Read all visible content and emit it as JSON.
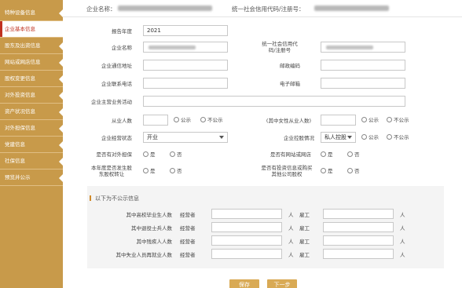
{
  "sidebar": {
    "items": [
      {
        "label": "特种设备信息"
      },
      {
        "label": "企业基本信息"
      },
      {
        "label": "股东及出资信息"
      },
      {
        "label": "网站或网店信息"
      },
      {
        "label": "股权变更信息"
      },
      {
        "label": "对外投资信息"
      },
      {
        "label": "资产状况信息"
      },
      {
        "label": "对外担保信息"
      },
      {
        "label": "党建信息"
      },
      {
        "label": "社保信息"
      },
      {
        "label": "预览并公示"
      }
    ]
  },
  "header": {
    "company_name_label": "企业名称：",
    "credit_code_label": "统一社会信用代码/注册号："
  },
  "form": {
    "report_year_label": "报告年度",
    "report_year_value": "2021",
    "company_name_label": "企业名称",
    "credit_code_label": "统一社会信用代码/注册号",
    "mailing_address_label": "企业通信地址",
    "postal_code_label": "邮政编码",
    "contact_phone_label": "企业联系电话",
    "email_label": "电子邮箱",
    "main_business_label": "企业主营业务活动",
    "employees_label": "从业人数",
    "female_employees_label": "(其中女性从业人数)",
    "public_label": "公示",
    "not_public_label": "不公示",
    "operating_status_label": "企业经营状态",
    "operating_status_value": "开业",
    "holding_label": "企业控股情况",
    "holding_value": "私人控股",
    "external_guarantee_label": "是否有对外担保",
    "website_label": "是否有网站或网店",
    "yes_label": "是",
    "no_label": "否",
    "equity_transfer_label": "本年度是否发生股东股权转让",
    "invest_label": "是否有投资信息或购买其他公司股权"
  },
  "non_public": {
    "title": "以下为不公示信息",
    "rows": [
      {
        "label": "其中高校毕业生人数",
        "operator": "经营者",
        "employee": "雇工",
        "unit": "人"
      },
      {
        "label": "其中退役士兵人数",
        "operator": "经营者",
        "employee": "雇工",
        "unit": "人"
      },
      {
        "label": "其中残疾人人数",
        "operator": "经营者",
        "employee": "雇工",
        "unit": "人"
      },
      {
        "label": "其中失业人员再就业人数",
        "operator": "经营者",
        "employee": "雇工",
        "unit": "人"
      }
    ]
  },
  "buttons": {
    "save": "保存",
    "submit": "下一步"
  },
  "colors": {
    "sidebar_bg": "#c89a4a",
    "active_text": "#c0311f",
    "button_bg": "#d9aa55"
  }
}
